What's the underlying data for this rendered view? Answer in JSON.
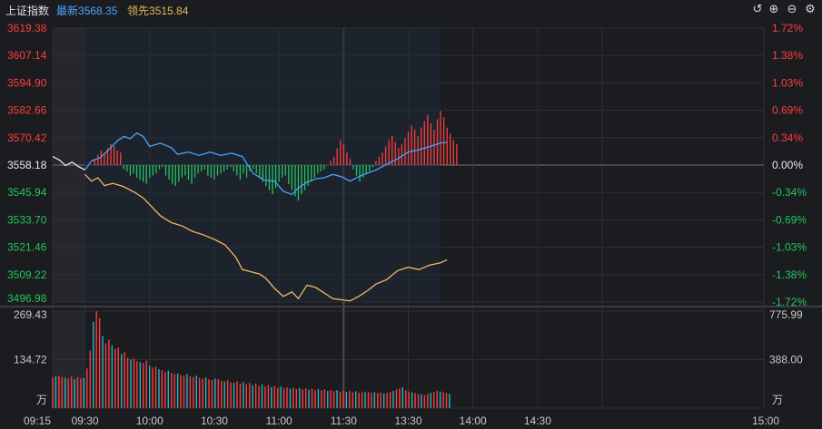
{
  "header": {
    "title": "上证指数",
    "latest_label": "最新",
    "latest_value": "3568.35",
    "leading_label": "领先",
    "leading_value": "3515.84"
  },
  "toolbar": {
    "icons": [
      "undo-icon",
      "zoom-in-icon",
      "zoom-out-icon",
      "settings-icon"
    ]
  },
  "colors": {
    "up": "#ff3c3c",
    "down": "#22c55e",
    "flat": "#e8e8e8",
    "index_line": "#4aa3ff",
    "leading_line": "#f0b860",
    "grid": "#2e3036",
    "bg": "#1b1c20"
  },
  "chart_data": [
    {
      "type": "line",
      "title": "",
      "ylim": [
        3496.98,
        3619.38
      ],
      "y_ticks_left": [
        "3619.38",
        "3607.14",
        "3594.90",
        "3582.66",
        "3570.42",
        "3558.18",
        "3545.94",
        "3533.70",
        "3521.46",
        "3509.22",
        "3496.98"
      ],
      "y_ticks_right": [
        "1.72%",
        "1.38%",
        "1.03%",
        "0.69%",
        "0.34%",
        "0.00%",
        "-0.34%",
        "-0.69%",
        "-1.03%",
        "-1.38%",
        "-1.72%"
      ],
      "x_ticks": [
        "09:15",
        "09:30",
        "10:00",
        "10:30",
        "11:00",
        "11:30",
        "13:30",
        "14:00",
        "14:30",
        "15:00"
      ],
      "prev_close": 3558.18,
      "series": [
        {
          "key": "auction",
          "points": [
            [
              0,
              3562
            ],
            [
              3,
              3560.5
            ],
            [
              6,
              3558
            ],
            [
              9,
              3559.5
            ],
            [
              12,
              3557.5
            ],
            [
              15,
              3556
            ]
          ]
        },
        {
          "key": "index",
          "points": [
            [
              15,
              3556
            ],
            [
              18,
              3560
            ],
            [
              22,
              3561.5
            ],
            [
              26,
              3565
            ],
            [
              30,
              3569
            ],
            [
              33,
              3571
            ],
            [
              36,
              3570
            ],
            [
              39,
              3572.5
            ],
            [
              42,
              3571
            ],
            [
              45,
              3566.5
            ],
            [
              50,
              3568
            ],
            [
              55,
              3566
            ],
            [
              58,
              3563
            ],
            [
              63,
              3564
            ],
            [
              68,
              3562.5
            ],
            [
              73,
              3564
            ],
            [
              78,
              3562.5
            ],
            [
              83,
              3563.5
            ],
            [
              88,
              3562
            ],
            [
              93,
              3554.5
            ],
            [
              98,
              3551.5
            ],
            [
              103,
              3551
            ],
            [
              107,
              3546.5
            ],
            [
              111,
              3545
            ],
            [
              114,
              3548
            ],
            [
              118,
              3550.5
            ],
            [
              122,
              3552
            ],
            [
              126,
              3552.5
            ],
            [
              130,
              3554
            ],
            [
              134,
              3553
            ],
            [
              138,
              3551
            ],
            [
              142,
              3553
            ],
            [
              146,
              3554.5
            ],
            [
              150,
              3556
            ],
            [
              155,
              3558.5
            ],
            [
              160,
              3561
            ],
            [
              165,
              3564
            ],
            [
              170,
              3565
            ],
            [
              175,
              3566.5
            ],
            [
              180,
              3568
            ],
            [
              183,
              3568.35
            ]
          ]
        },
        {
          "key": "leading",
          "points": [
            [
              15,
              3554
            ],
            [
              18,
              3551
            ],
            [
              21,
              3552.5
            ],
            [
              24,
              3549
            ],
            [
              28,
              3550
            ],
            [
              33,
              3548.5
            ],
            [
              38,
              3546
            ],
            [
              42,
              3543.5
            ],
            [
              46,
              3539.5
            ],
            [
              50,
              3535.5
            ],
            [
              55,
              3532.5
            ],
            [
              60,
              3531
            ],
            [
              65,
              3528.5
            ],
            [
              70,
              3527
            ],
            [
              75,
              3525
            ],
            [
              80,
              3522.5
            ],
            [
              85,
              3517
            ],
            [
              88,
              3511.5
            ],
            [
              92,
              3510.5
            ],
            [
              96,
              3509.5
            ],
            [
              99,
              3507.5
            ],
            [
              103,
              3503
            ],
            [
              107,
              3499.5
            ],
            [
              111,
              3501.5
            ],
            [
              114,
              3498.5
            ],
            [
              118,
              3504.5
            ],
            [
              122,
              3503.5
            ],
            [
              126,
              3501
            ],
            [
              130,
              3498.5
            ],
            [
              134,
              3498
            ],
            [
              138,
              3497.5
            ],
            [
              142,
              3499.5
            ],
            [
              146,
              3502
            ],
            [
              150,
              3505
            ],
            [
              155,
              3507
            ],
            [
              160,
              3511
            ],
            [
              165,
              3512.5
            ],
            [
              170,
              3511.5
            ],
            [
              175,
              3513.5
            ],
            [
              180,
              3514.5
            ],
            [
              183,
              3515.84
            ]
          ]
        }
      ],
      "diff_bars": [
        0,
        0,
        0,
        3,
        5,
        7,
        6,
        8,
        10,
        9,
        7,
        6,
        -2,
        -3,
        -5,
        -4,
        -6,
        -7,
        -8,
        -9,
        -6,
        -5,
        -4,
        -2,
        -1,
        -5,
        -7,
        -9,
        -10,
        -8,
        -6,
        -5,
        -7,
        -9,
        -6,
        -4,
        -3,
        -2,
        -5,
        -6,
        -7,
        -5,
        -4,
        -3,
        -2,
        -1,
        -3,
        -5,
        -7,
        -4,
        -6,
        -3,
        -2,
        -4,
        -6,
        -8,
        -10,
        -12,
        -14,
        -11,
        -8,
        -6,
        -5,
        -9,
        -12,
        -15,
        -17,
        -14,
        -12,
        -10,
        -8,
        -6,
        -4,
        -3,
        -2,
        0,
        2,
        4,
        8,
        12,
        10,
        6,
        3,
        -2,
        -5,
        -8,
        -6,
        -4,
        -3,
        -1,
        2,
        4,
        6,
        9,
        12,
        14,
        11,
        8,
        10,
        13,
        16,
        19,
        17,
        14,
        18,
        21,
        24,
        20,
        17,
        22,
        26,
        23,
        18,
        15,
        12,
        10
      ]
    },
    {
      "type": "bar",
      "title": "",
      "ylim": [
        0,
        269.43
      ],
      "y_ticks_left": [
        "269.43",
        "134.72",
        "万"
      ],
      "y_ticks_right": [
        "775.99",
        "388.00",
        "万"
      ],
      "volumes": [
        85,
        88,
        90,
        86,
        84,
        82,
        88,
        80,
        86,
        82,
        84,
        110,
        160,
        240,
        269,
        250,
        200,
        180,
        190,
        175,
        165,
        168,
        150,
        155,
        140,
        135,
        138,
        130,
        128,
        125,
        132,
        118,
        112,
        115,
        108,
        105,
        100,
        104,
        98,
        95,
        96,
        92,
        90,
        94,
        88,
        86,
        90,
        84,
        82,
        85,
        80,
        78,
        82,
        80,
        76,
        74,
        78,
        72,
        70,
        75,
        68,
        72,
        66,
        70,
        64,
        68,
        62,
        66,
        60,
        64,
        58,
        62,
        56,
        60,
        55,
        58,
        54,
        57,
        53,
        56,
        52,
        55,
        51,
        54,
        50,
        53,
        49,
        52,
        48,
        51,
        47,
        50,
        46,
        49,
        45,
        48,
        44,
        47,
        43,
        46,
        44,
        45,
        43,
        44,
        42,
        43,
        41,
        42,
        45,
        48,
        52,
        55,
        58,
        50,
        46,
        44,
        42,
        40,
        38,
        36,
        40,
        42,
        45,
        48,
        46,
        44,
        42,
        40
      ]
    }
  ]
}
